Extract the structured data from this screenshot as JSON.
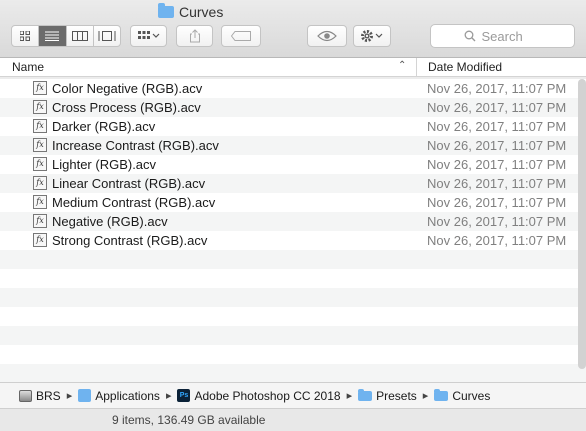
{
  "window": {
    "title": "Curves"
  },
  "toolbar": {
    "view_modes": [
      "icon-view",
      "list-view",
      "column-view",
      "cover-flow-view"
    ],
    "active_view": 1,
    "search_placeholder": "Search"
  },
  "columns": {
    "name": "Name",
    "date": "Date Modified"
  },
  "files": [
    {
      "name": "Color Negative (RGB).acv",
      "date": "Nov 26, 2017, 11:07 PM"
    },
    {
      "name": "Cross Process (RGB).acv",
      "date": "Nov 26, 2017, 11:07 PM"
    },
    {
      "name": "Darker (RGB).acv",
      "date": "Nov 26, 2017, 11:07 PM"
    },
    {
      "name": "Increase Contrast (RGB).acv",
      "date": "Nov 26, 2017, 11:07 PM"
    },
    {
      "name": "Lighter (RGB).acv",
      "date": "Nov 26, 2017, 11:07 PM"
    },
    {
      "name": "Linear Contrast (RGB).acv",
      "date": "Nov 26, 2017, 11:07 PM"
    },
    {
      "name": "Medium Contrast (RGB).acv",
      "date": "Nov 26, 2017, 11:07 PM"
    },
    {
      "name": "Negative (RGB).acv",
      "date": "Nov 26, 2017, 11:07 PM"
    },
    {
      "name": "Strong Contrast (RGB).acv",
      "date": "Nov 26, 2017, 11:07 PM"
    }
  ],
  "file_icon_text": "fx",
  "path": [
    "BRS",
    "Applications",
    "Adobe Photoshop CC 2018",
    "Presets",
    "Curves"
  ],
  "ps_icon_text": "Ps",
  "status": "9 items, 136.49 GB available",
  "colors": {
    "folder": "#6fb3ef",
    "active_segment": "#6b6b6b"
  }
}
